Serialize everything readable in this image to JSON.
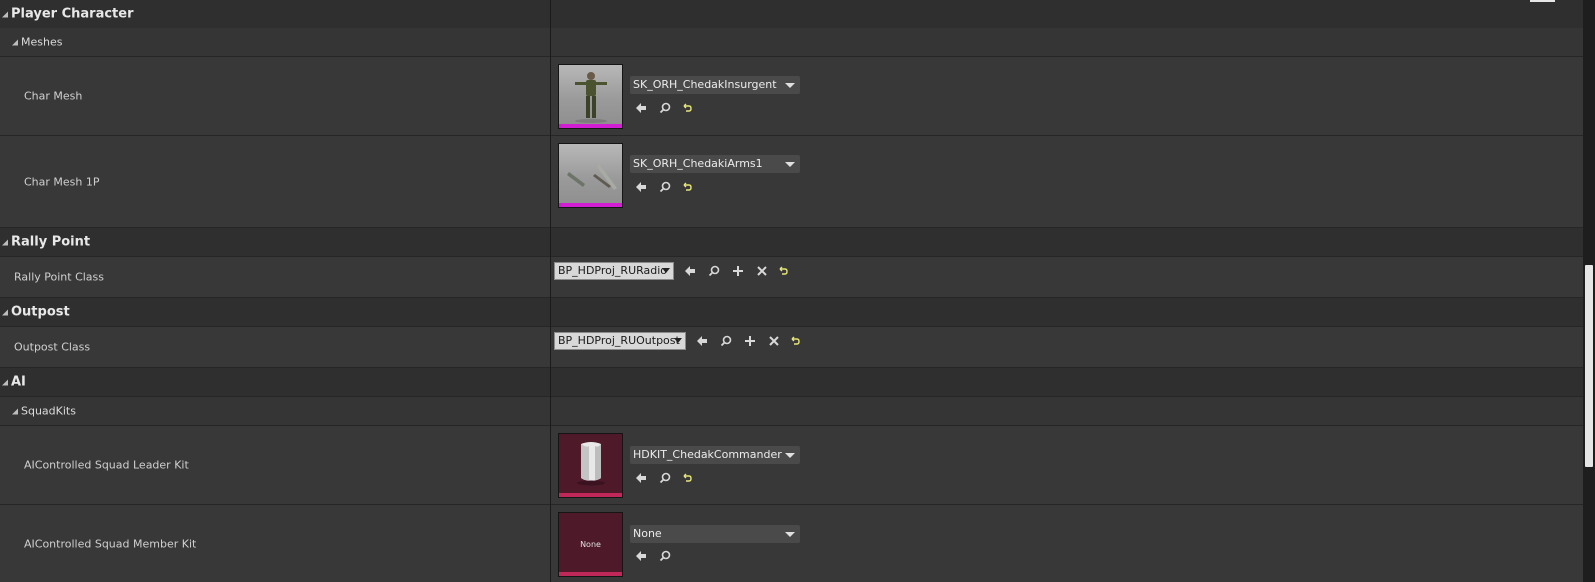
{
  "categories": {
    "player_character": "Player Character",
    "meshes": "Meshes",
    "rally_point": "Rally Point",
    "outpost": "Outpost",
    "ai": "AI",
    "squad_kits": "SquadKits"
  },
  "properties": {
    "char_mesh": {
      "label": "Char Mesh",
      "value": "SK_ORH_ChedakInsurgent"
    },
    "char_mesh_1p": {
      "label": "Char Mesh 1P",
      "value": "SK_ORH_ChedakiArms1"
    },
    "rally_point_class": {
      "label": "Rally Point Class",
      "value": "BP_HDProj_RURadio"
    },
    "outpost_class": {
      "label": "Outpost Class",
      "value": "BP_HDProj_RUOutpost"
    },
    "squad_leader_kit": {
      "label": "AIControlled Squad Leader Kit",
      "value": "HDKIT_ChedakCommander"
    },
    "squad_member_kit": {
      "label": "AIControlled Squad Member Kit",
      "value": "None",
      "thumb_text": "None"
    }
  },
  "colors": {
    "mesh_bar": "#d21ed2",
    "kit_bar": "#c0285a",
    "reset_icon": "#e6e67a",
    "panel_bg": "#383838"
  },
  "icons": {
    "use_selected": "arrow-left-icon",
    "browse": "magnifier-icon",
    "add": "plus-icon",
    "clear": "x-icon",
    "reset": "reset-to-default-icon"
  }
}
